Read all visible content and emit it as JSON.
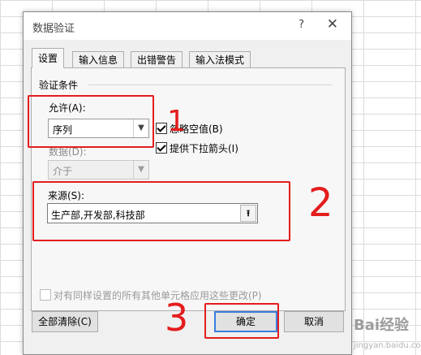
{
  "dialog": {
    "title": "数据验证",
    "help_glyph": "?",
    "close_glyph": "✕"
  },
  "tabs": [
    {
      "label": "设置",
      "active": true
    },
    {
      "label": "输入信息",
      "active": false
    },
    {
      "label": "出错警告",
      "active": false
    },
    {
      "label": "输入法模式",
      "active": false
    }
  ],
  "settings": {
    "group_label": "验证条件",
    "allow_label": "允许(A):",
    "allow_value": "序列",
    "ignore_blank_label": "忽略空值(B)",
    "ignore_blank_checked": true,
    "dropdown_label": "提供下拉箭头(I)",
    "dropdown_checked": true,
    "data_label": "数据(D):",
    "data_value": "介于",
    "source_label": "来源(S):",
    "source_value": "生产部,开发部,科技部",
    "apply_all_label": "对有同样设置的所有其他单元格应用这些更改(P)",
    "apply_all_checked": false
  },
  "footer": {
    "clear_all_label": "全部清除(C)",
    "ok_label": "确定",
    "cancel_label": "取消"
  },
  "annotations": {
    "one": "1",
    "two": "2",
    "three": "3",
    "color": "#e41d1d"
  },
  "watermark": {
    "brand": "Bai",
    "brand_suffix": "经验",
    "url": "jingyan.baidu.com"
  }
}
